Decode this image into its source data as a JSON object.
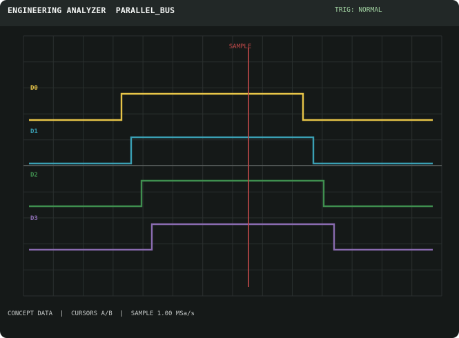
{
  "header": {
    "title": "ENGINEERING ANALYZER  PARALLEL_BUS",
    "trigger_status": "TRIG: NORMAL"
  },
  "marker": {
    "label": "SAMPLE",
    "color": "#c44a4a"
  },
  "channels": [
    {
      "name": "D0",
      "color": "#e8c548"
    },
    {
      "name": "D1",
      "color": "#3aa0b4"
    },
    {
      "name": "D2",
      "color": "#3f8f4f"
    },
    {
      "name": "D3",
      "color": "#8a6bb0"
    }
  ],
  "footer": {
    "text": "CONCEPT DATA  |  CURSORS A/B  |  SAMPLE 1.00 MSa/s"
  },
  "colors": {
    "background": "#151918",
    "header": "#222827",
    "grid": "#2a302f",
    "centerline": "#5e6362"
  }
}
